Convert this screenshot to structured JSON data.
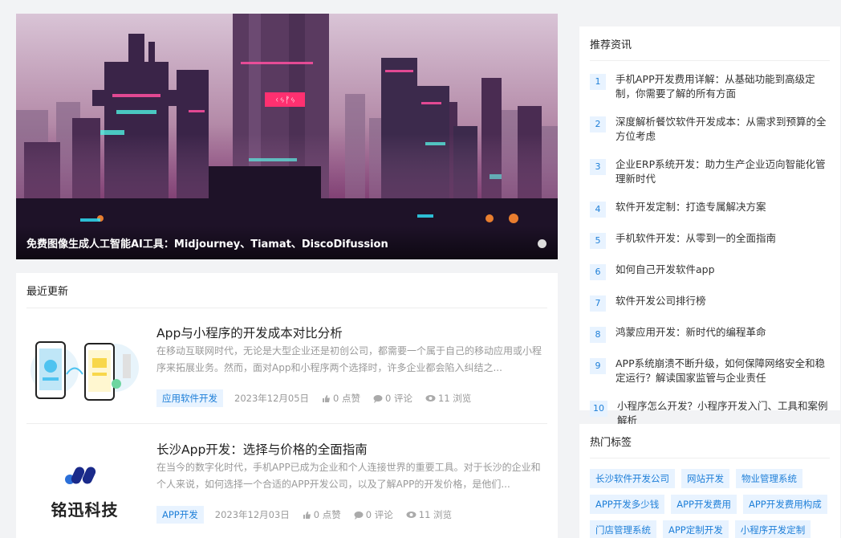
{
  "hero": {
    "caption": "免费图像生成人工智能AI工具：Midjourney、Tiamat、DiscoDifussion",
    "sign_text": "ᚲᛃᚠᛃ"
  },
  "latest": {
    "title": "最近更新",
    "articles": [
      {
        "title": "App与小程序的开发成本对比分析",
        "excerpt": "在移动互联网时代，无论是大型企业还是初创公司，都需要一个属于自己的移动应用或小程序来拓展业务。然而，面对App和小程序两个选择时，许多企业都会陷入纠结之...",
        "tag": "应用软件开发",
        "date": "2023年12月05日",
        "likes": "0 点赞",
        "comments": "0 评论",
        "views": "11 浏览"
      },
      {
        "title": "长沙App开发：选择与价格的全面指南",
        "excerpt": "在当今的数字化时代，手机APP已成为企业和个人连接世界的重要工具。对于长沙的企业和个人来说，如何选择一个合适的APP开发公司，以及了解APP的开发价格，是他们...",
        "tag": "APP开发",
        "date": "2023年12月03日",
        "likes": "0 点赞",
        "comments": "0 评论",
        "views": "11 浏览",
        "logo_text": "铭迅科技"
      }
    ]
  },
  "recommended": {
    "title": "推荐资讯",
    "items": [
      {
        "num": "1",
        "text": "手机APP开发费用详解：从基础功能到高级定制，你需要了解的所有方面"
      },
      {
        "num": "2",
        "text": "深度解析餐饮软件开发成本：从需求到预算的全方位考虑"
      },
      {
        "num": "3",
        "text": "企业ERP系统开发：助力生产企业迈向智能化管理新时代"
      },
      {
        "num": "4",
        "text": "软件开发定制：打造专属解决方案"
      },
      {
        "num": "5",
        "text": "手机软件开发：从零到一的全面指南"
      },
      {
        "num": "6",
        "text": "如何自己开发软件app"
      },
      {
        "num": "7",
        "text": "软件开发公司排行榜"
      },
      {
        "num": "8",
        "text": "鸿蒙应用开发：新时代的编程革命"
      },
      {
        "num": "9",
        "text": "APP系统崩溃不断升级，如何保障网络安全和稳定运行？解读国家监管与企业责任"
      },
      {
        "num": "10",
        "text": "小程序怎么开发？小程序开发入门、工具和案例解析"
      }
    ]
  },
  "hot_tags": {
    "title": "热门标签",
    "tags": [
      "长沙软件开发公司",
      "网站开发",
      "物业管理系统",
      "APP开发多少钱",
      "APP开发费用",
      "APP开发费用构成",
      "门店管理系统",
      "APP定制开发",
      "小程序开发定制"
    ]
  },
  "colors": {
    "accent": "#1e7fd8",
    "tag_bg": "#e8f3ff",
    "page_bg": "#f2f3f5"
  }
}
